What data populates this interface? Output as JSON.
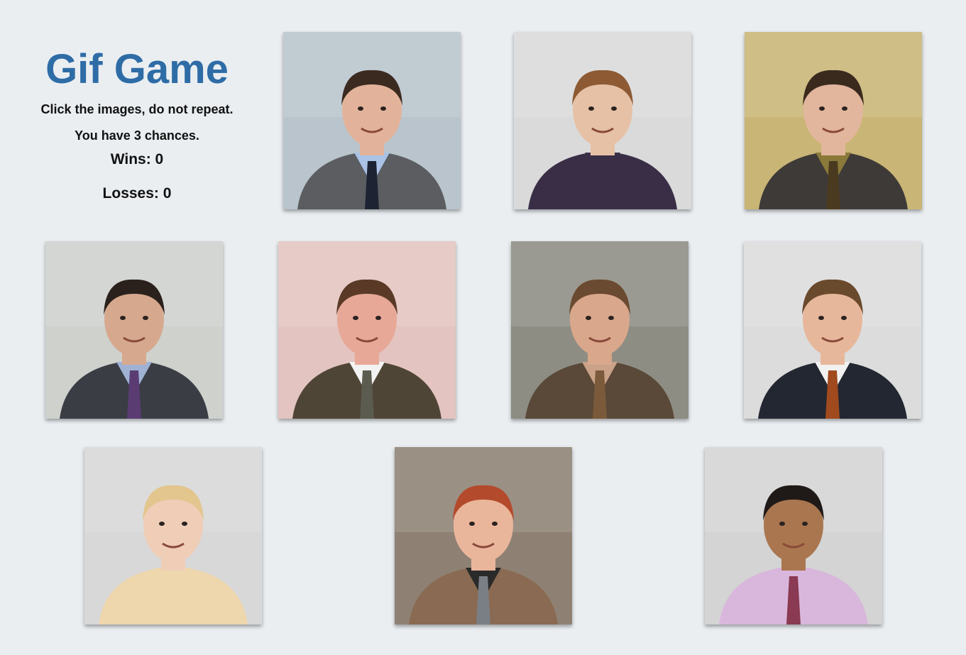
{
  "game": {
    "title": "Gif Game",
    "instructions": "Click the images, do not repeat.",
    "chances_text": "You have 3 chances.",
    "wins_text": "Wins: 0",
    "losses_text": "Losses: 0"
  },
  "cards": [
    {
      "name": "card-jim",
      "bg": "#b9c4cc",
      "suit": "#5b5d60",
      "shirt": "#a9c2e6",
      "tie": "#1d2333",
      "skin": "#e2b39a",
      "hair": "#3b2a20"
    },
    {
      "name": "card-pam",
      "bg": "#dadada",
      "suit": "#3a2e47",
      "shirt": "#3a2e47",
      "tie": "#3a2e47",
      "skin": "#e6c1a6",
      "hair": "#8d5a34"
    },
    {
      "name": "card-dwight",
      "bg": "#c9b575",
      "suit": "#3e3a38",
      "shirt": "#8a7a3a",
      "tie": "#4a3a20",
      "skin": "#e2b69c",
      "hair": "#3a2a1e"
    },
    {
      "name": "card-michael",
      "bg": "#cfd1cd",
      "suit": "#3a3d44",
      "shirt": "#9fb2d4",
      "tie": "#5a3c73",
      "skin": "#d6a98e",
      "hair": "#2b211c"
    },
    {
      "name": "card-kevin",
      "bg": "#e3c4c0",
      "suit": "#4f4536",
      "shirt": "#f2f2f2",
      "tie": "#5b5b4f",
      "skin": "#e7a897",
      "hair": "#5a3a26"
    },
    {
      "name": "card-toby",
      "bg": "#8e8d83",
      "suit": "#5a4838",
      "shirt": "#caa288",
      "tie": "#7a5a3a",
      "skin": "#d9a78b",
      "hair": "#6a4a30"
    },
    {
      "name": "card-andy",
      "bg": "#dcdcdc",
      "suit": "#232731",
      "shirt": "#f1f1f1",
      "tie": "#a04a1e",
      "skin": "#e7b79b",
      "hair": "#6a4a2c"
    },
    {
      "name": "card-angela",
      "bg": "#d8d8d8",
      "suit": "#eed6ad",
      "shirt": "#eed6ad",
      "tie": "#eed6ad",
      "skin": "#efcdb7",
      "hair": "#e3c68e"
    },
    {
      "name": "card-meredith",
      "bg": "#8e8173",
      "suit": "#8a6a52",
      "shirt": "#2a2a2a",
      "tie": "#7a7f86",
      "skin": "#eab69b",
      "hair": "#b44a2c"
    },
    {
      "name": "card-oscar",
      "bg": "#d4d4d4",
      "suit": "#d9b7dc",
      "shirt": "#d9b7dc",
      "tie": "#8a3a52",
      "skin": "#a9764f",
      "hair": "#1f1a18"
    }
  ]
}
